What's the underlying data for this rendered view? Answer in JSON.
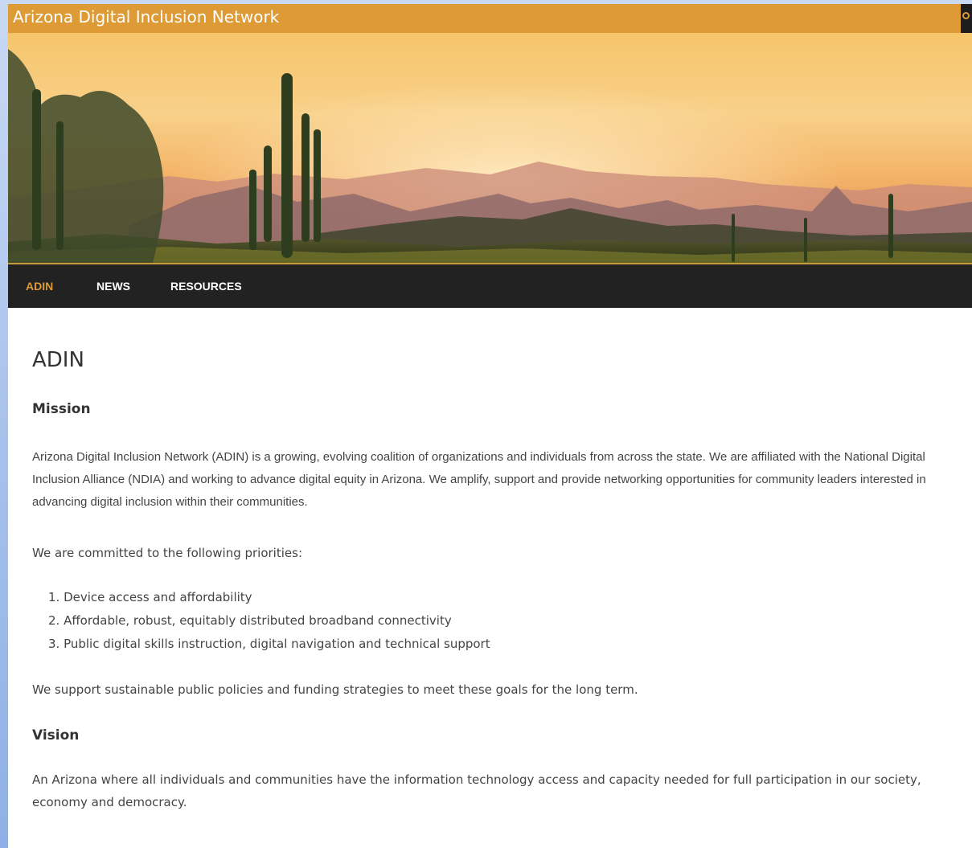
{
  "site": {
    "title": "Arizona Digital Inclusion Network"
  },
  "nav": {
    "items": [
      {
        "label": "ADIN",
        "active": true
      },
      {
        "label": "NEWS",
        "active": false
      },
      {
        "label": "RESOURCES",
        "active": false
      }
    ]
  },
  "page": {
    "title": "ADIN",
    "mission_heading": "Mission",
    "mission_text": "Arizona Digital Inclusion Network (ADIN) is a growing, evolving coalition of organizations and individuals from across the state. We are affiliated with the National Digital Inclusion Alliance (NDIA) and working to advance digital equity in Arizona. We amplify, support and provide networking opportunities for community leaders interested in advancing digital inclusion within their communities.",
    "priorities_intro": "We are committed to the following priorities:",
    "priorities": [
      "1. Device access and affordability",
      "2. Affordable, robust, equitably distributed broadband connectivity",
      "3. Public digital skills instruction, digital navigation and technical support"
    ],
    "support_text": "We support sustainable public policies and funding strategies to meet these goals for the long term.",
    "vision_heading": "Vision",
    "vision_text": "An Arizona where all individuals and communities have the information technology access and capacity needed for full participation in our society, economy and democracy."
  },
  "colors": {
    "accent": "#dd9a35",
    "nav_background": "#222222",
    "text": "#444444"
  },
  "icons": {
    "search": "search-icon"
  }
}
